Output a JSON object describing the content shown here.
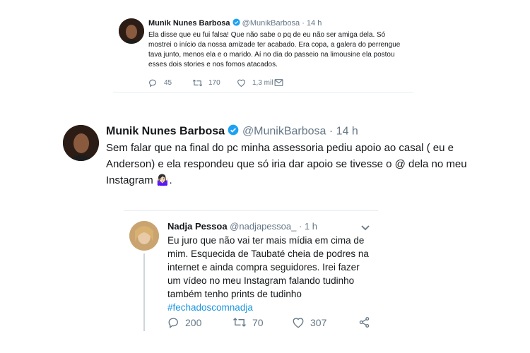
{
  "tweet1": {
    "name": "Munik Nunes Barbosa",
    "handle": "@MunikBarbosa",
    "time": "· 14 h",
    "text": "Ela disse que eu fui falsa! Que não sabe o pq de eu não ser amiga dela. Só mostrei o início da nossa amizade ter acabado. Era copa, a galera do perrengue tava junto, menos ela e o marido. Aí no dia do passeio na limousine ela postou esses dois stories e nos fomos atacados.",
    "replies": "45",
    "retweets": "170",
    "likes": "1,3 mil"
  },
  "tweet2": {
    "name": "Munik Nunes Barbosa",
    "handle": "@MunikBarbosa",
    "time": "· 14 h",
    "text": "Sem falar que na final do pc minha assessoria pediu apoio ao casal ( eu e Anderson) e ela respondeu que só iria dar apoio se tivesse o @ dela no meu Instagram",
    "emoji_suffix": " 🤷🏻‍♀️.",
    "emoji": "woman-shrugging-emoji"
  },
  "tweet3": {
    "name": "Nadja Pessoa",
    "handle": "@nadjapessoa_",
    "time": "· 1 h",
    "text": "Eu juro que não vai ter mais mídia em cima de mim. Esquecida de Taubaté cheia de podres na internet e ainda compra seguidores. Irei fazer um vídeo no meu Instagram falando tudinho também tenho prints de tudinho",
    "hashtag": "#fechadoscomnadja",
    "replies": "200",
    "retweets": "70",
    "likes": "307"
  },
  "colors": {
    "text": "#14171a",
    "muted": "#657786",
    "verified": "#1da1f2",
    "link": "#1b95e0"
  },
  "icons": [
    "reply-icon",
    "retweet-icon",
    "like-icon",
    "dm-icon",
    "share-icon",
    "caret-down-icon",
    "verified-icon"
  ]
}
